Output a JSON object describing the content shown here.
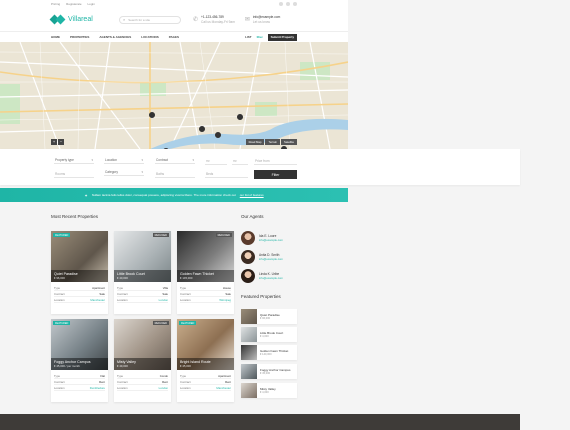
{
  "topbar": {
    "links": [
      "Pricing",
      "Registerate",
      "Login"
    ]
  },
  "brand": {
    "name": "Villareal",
    "accent": "#1fb5a6"
  },
  "search": {
    "placeholder": "Search for a site"
  },
  "contact": {
    "phone": "+1-123-456-789",
    "phone_sub": "Call us Monday-Fri 9am",
    "email": "info@example.com",
    "email_sub": "Let us know"
  },
  "nav": {
    "items": [
      "HOME",
      "PROPERTIES",
      "AGENTS & AGENCIES",
      "LOCATIONS",
      "PAGES"
    ],
    "list": "LIST",
    "favorites": "0fav",
    "submit": "Submit Property"
  },
  "map": {
    "types": [
      "Road Map",
      "Terrain",
      "Satellite"
    ]
  },
  "form": {
    "property_type": "Property type",
    "location": "Location",
    "contract": "Contract",
    "rooms": "Rooms",
    "category": "Category",
    "baths": "Baths",
    "beds": "Beds",
    "price_from": "Price from",
    "price_to": "Price to",
    "area_from": "m²",
    "area_to": "m²",
    "filter": "Filter"
  },
  "banner": {
    "text": "Nullam lacinia felis tellus dolor, consequat posuere, adipiscing viverra libero. The more information check out",
    "link": "our list of features"
  },
  "recent": {
    "title": "Most Recent Properties",
    "labels": {
      "type": "Type",
      "contract": "Contract",
      "location": "Location"
    },
    "cards": [
      {
        "name": "Quiet Paradise",
        "price": "€ 96,000",
        "type": "Apartment",
        "contract": "Sale",
        "location": "Manchester",
        "badge": "FEATURED",
        "badge_kind": "feat"
      },
      {
        "name": "Little Brook Court",
        "price": "€ 40,000",
        "type": "Villa",
        "contract": "Sale",
        "location": "London",
        "badge": "REDUCED",
        "badge_kind": "red"
      },
      {
        "name": "Golden Fawn Thicket",
        "price": "€ 145,000",
        "type": "House",
        "contract": "Sale",
        "location": "Winnipeg",
        "badge": "REDUCED",
        "badge_kind": "red"
      },
      {
        "name": "Foggy Anchor Campus",
        "price": "€ 45,000 / per month",
        "type": "Flat",
        "contract": "Rent",
        "location": "Dumbledore",
        "badge": "FEATURED",
        "badge_kind": "feat"
      },
      {
        "name": "Misty Valley",
        "price": "€ 49,000",
        "type": "Condo",
        "contract": "Rent",
        "location": "London",
        "badge": "REDUCED",
        "badge_kind": "red"
      },
      {
        "name": "Bright Island Route",
        "price": "€ 45,000",
        "type": "Apartment",
        "contract": "Rent",
        "location": "Manchester",
        "badge": "FEATURED",
        "badge_kind": "feat"
      }
    ]
  },
  "agents": {
    "title": "Our Agents",
    "items": [
      {
        "name": "Ida E. Loore",
        "email": "info@example.com"
      },
      {
        "name": "Anita D. Smith",
        "email": "info@example.com"
      },
      {
        "name": "Linda K. Uribe",
        "email": "info@example.com"
      }
    ]
  },
  "featured": {
    "title": "Featured Properties",
    "items": [
      {
        "name": "Quiet Paradise",
        "price": "€ 96,000"
      },
      {
        "name": "Little Brook Court",
        "price": "€ 4,000"
      },
      {
        "name": "Golden Fawn Thicket",
        "price": "€ 140,000"
      },
      {
        "name": "Foggy Anchor Campus",
        "price": "€ 45,000"
      },
      {
        "name": "Misty Valley",
        "price": "€ 4,000"
      }
    ]
  }
}
